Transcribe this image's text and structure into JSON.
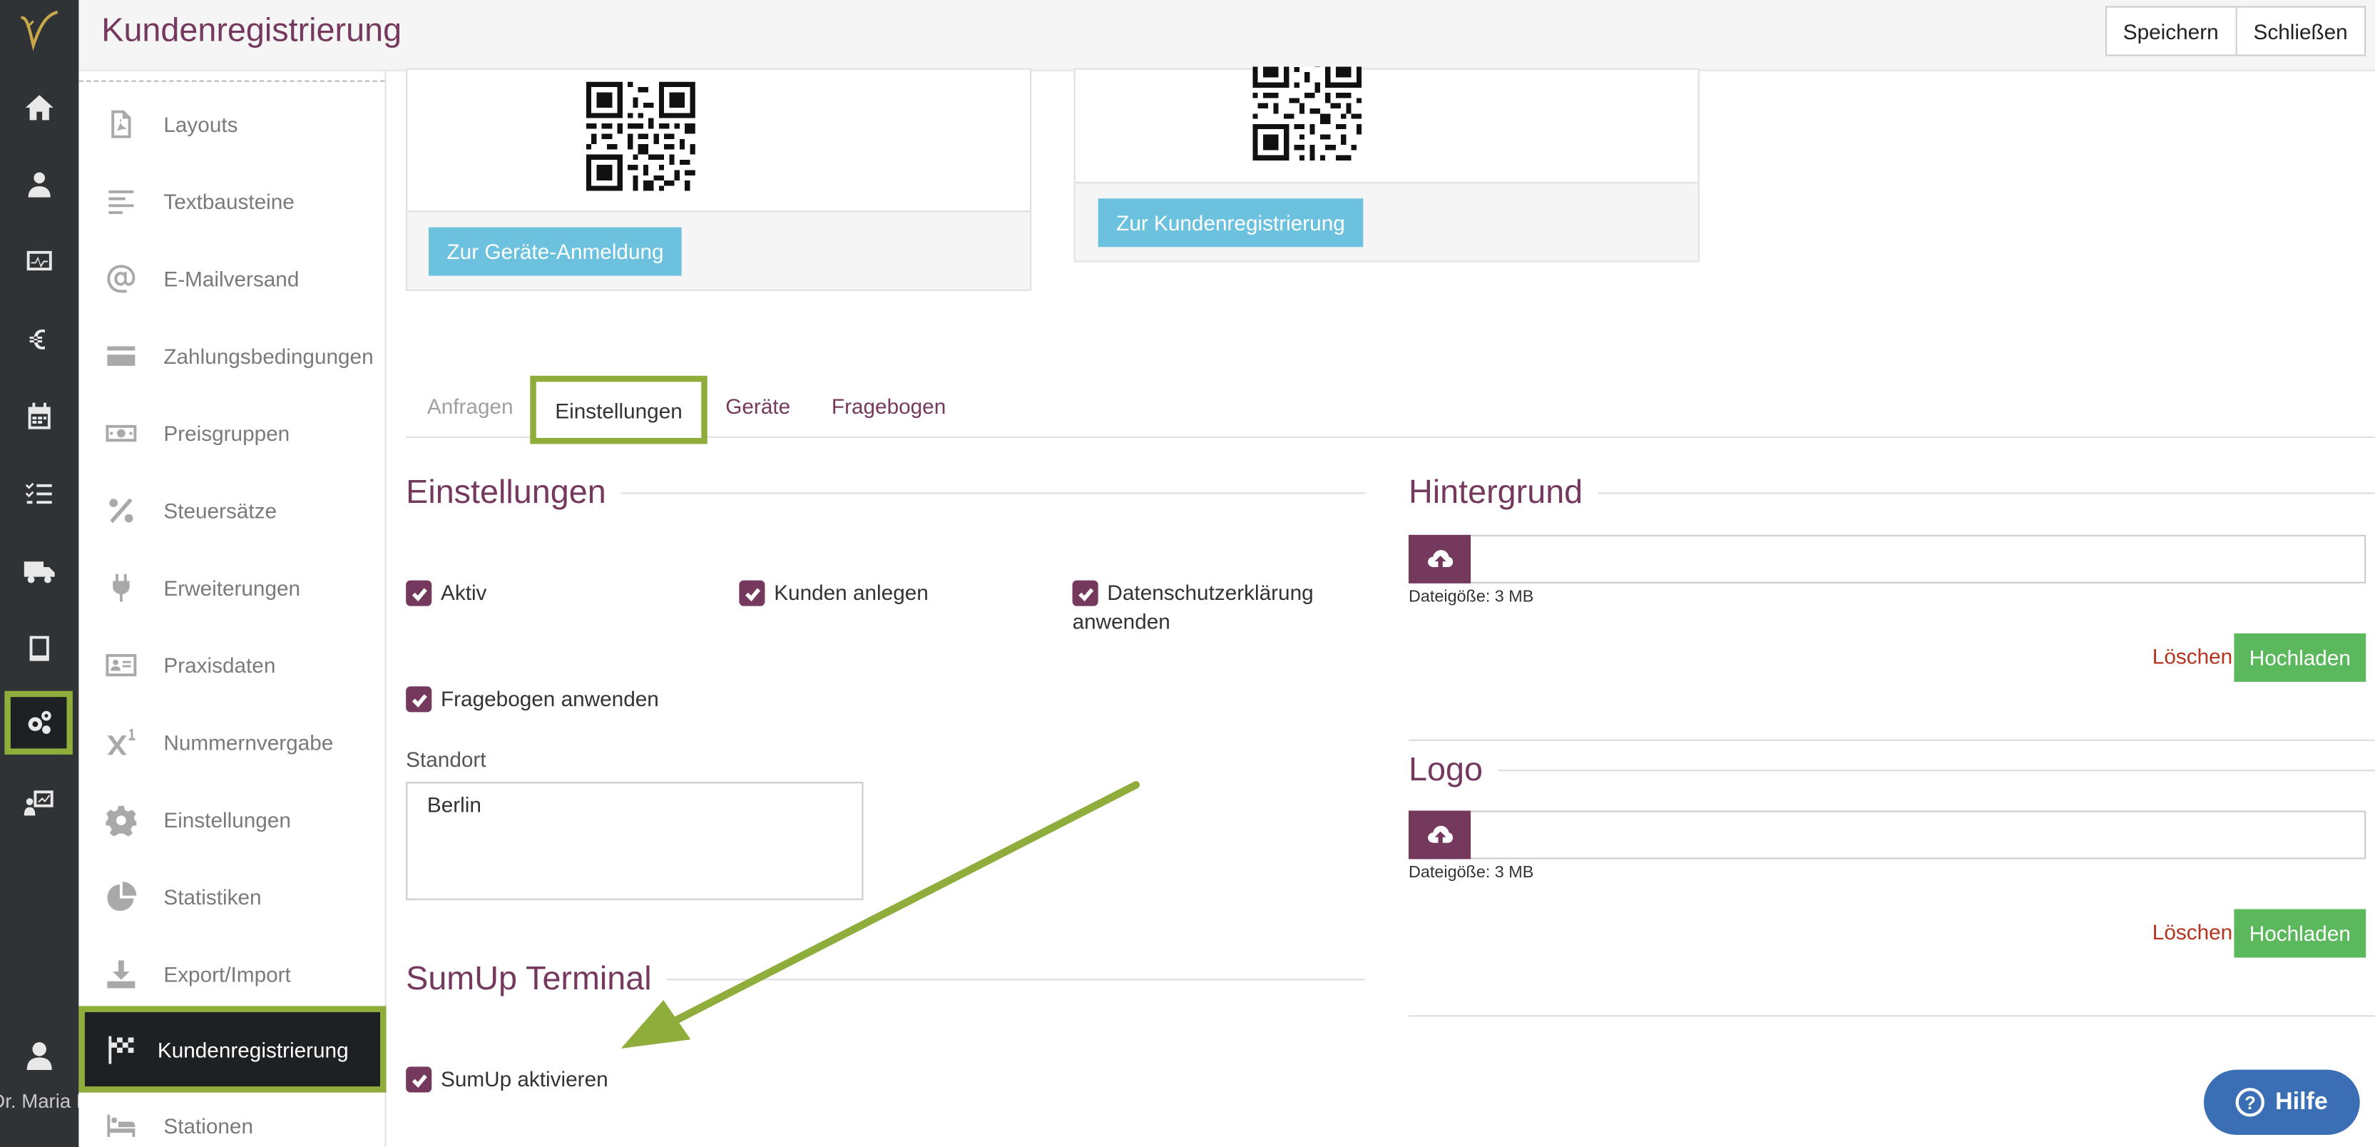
{
  "header": {
    "title": "Kundenregistrierung",
    "save_label": "Speichern",
    "close_label": "Schließen"
  },
  "rail": {
    "items": [
      "home-icon",
      "customers-icon",
      "monitor-icon",
      "euro-icon",
      "calendar-icon",
      "tasks-icon",
      "truck-icon",
      "book-icon",
      "settings-icon",
      "chart-board-icon"
    ],
    "active": "settings-icon",
    "user_name": "Dr. Maria Müller"
  },
  "sidebar": {
    "items": [
      {
        "icon": "pdf-icon",
        "label": "Layouts"
      },
      {
        "icon": "text-lines-icon",
        "label": "Textbausteine"
      },
      {
        "icon": "at-icon",
        "label": "E-Mailversand"
      },
      {
        "icon": "credit-card-icon",
        "label": "Zahlungsbedingungen"
      },
      {
        "icon": "money-icon",
        "label": "Preisgruppen"
      },
      {
        "icon": "percent-icon",
        "label": "Steuersätze"
      },
      {
        "icon": "plug-icon",
        "label": "Erweiterungen"
      },
      {
        "icon": "id-card-icon",
        "label": "Praxisdaten"
      },
      {
        "icon": "superscript-icon",
        "label": "Nummernvergabe"
      },
      {
        "icon": "gear-icon",
        "label": "Einstellungen"
      },
      {
        "icon": "pie-chart-icon",
        "label": "Statistiken"
      },
      {
        "icon": "download-icon",
        "label": "Export/Import"
      },
      {
        "icon": "flag-checkered-icon",
        "label": "Kundenregistrierung"
      },
      {
        "icon": "bed-icon",
        "label": "Stationen"
      }
    ],
    "active": "Kundenregistrierung"
  },
  "cards": {
    "device_button": "Zur Geräte-Anmeldung",
    "registration_button": "Zur Kundenregistrierung"
  },
  "tabs": [
    {
      "label": "Anfragen"
    },
    {
      "label": "Einstellungen"
    },
    {
      "label": "Geräte"
    },
    {
      "label": "Fragebogen"
    }
  ],
  "settings": {
    "heading": "Einstellungen",
    "checkboxes": {
      "aktiv": "Aktiv",
      "kunden_anlegen": "Kunden anlegen",
      "datenschutz_line1": "Datenschutzerklärung",
      "datenschutz_line2": "anwenden",
      "fragebogen": "Fragebogen anwenden"
    },
    "standort_label": "Standort",
    "standort_value": "Berlin"
  },
  "sumup": {
    "heading": "SumUp Terminal",
    "checkbox": "SumUp aktivieren"
  },
  "hintergrund": {
    "heading": "Hintergrund",
    "hint": "Dateigöße: 3 MB",
    "delete": "Löschen",
    "upload": "Hochladen"
  },
  "logo": {
    "heading": "Logo",
    "hint": "Dateigöße: 3 MB",
    "delete": "Löschen",
    "upload": "Hochladen"
  },
  "help": {
    "label": "Hilfe",
    "icon": "question-icon"
  },
  "colors": {
    "brand": "#74395c",
    "highlight": "#8fad3a",
    "rail": "#2f3336",
    "blue_button": "#6bc1de",
    "green_button": "#5cb85c",
    "delete_link": "#b5331f",
    "help_button": "#3a6fb5"
  }
}
